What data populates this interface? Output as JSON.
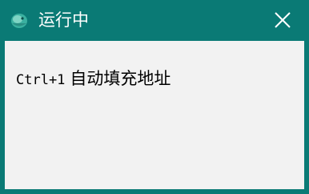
{
  "window": {
    "title": "运行中",
    "close_icon": "close-icon",
    "app_icon": "app-icon",
    "colors": {
      "titlebar": "#0a7a75",
      "content_bg": "#f2f2f2",
      "text": "#000000",
      "title_text": "#ffffff"
    }
  },
  "message": {
    "shortcut": "Ctrl+1",
    "action": "自动填充地址"
  }
}
